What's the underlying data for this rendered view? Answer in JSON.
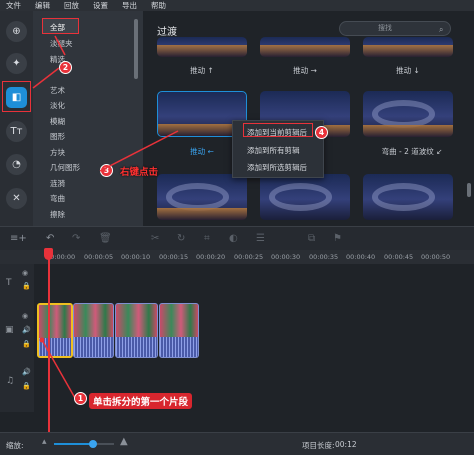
{
  "menubar": [
    "文件",
    "编辑",
    "回放",
    "设置",
    "导出",
    "帮助"
  ],
  "sidebar_icons": [
    "add-media-icon",
    "magic-wand-icon",
    "transitions-icon",
    "text-icon",
    "filters-icon",
    "tools-icon"
  ],
  "categories": {
    "items": [
      "全部",
      "淡褪夹",
      "精选",
      "",
      "艺术",
      "淡化",
      "模糊",
      "图形",
      "方块",
      "几何图形",
      "涟漪",
      "弯曲",
      "擦除"
    ],
    "selected": "全部"
  },
  "panel": {
    "title": "过渡",
    "search_placeholder": "搜找"
  },
  "transitions": [
    {
      "label": "推动 ↑"
    },
    {
      "label": "推动 →"
    },
    {
      "label": "推动 ↓"
    },
    {
      "label": "推动 ←",
      "selected": true
    },
    {
      "label": ""
    },
    {
      "label": "弯曲 - 2 道波纹 ↙"
    },
    {
      "label": ""
    },
    {
      "label": ""
    },
    {
      "label": ""
    }
  ],
  "context_menu": [
    "添加到当前剪辑后",
    "添加到所有剪辑",
    "添加到所选剪辑后"
  ],
  "annotations": {
    "step1": "单击拆分的第一个片段",
    "step2_num": "2",
    "step3": "右键点击",
    "step3_num": "3",
    "step4_num": "4",
    "step1_num": "1"
  },
  "ruler": [
    "00:00:00",
    "00:00:05",
    "00:00:10",
    "00:00:15",
    "00:00:20",
    "00:00:25",
    "00:00:30",
    "00:00:35",
    "00:00:40",
    "00:00:45",
    "00:00:50"
  ],
  "status": {
    "zoom_label": "缩放:",
    "zoom_level": 0.65,
    "project_length_label": "项目长度:",
    "project_length": "00:12"
  },
  "colors": {
    "accent": "#1e8fd8",
    "annotation": "#e8323a",
    "clip": "#5a6fb8",
    "clip_highlight": "#f0c020"
  }
}
